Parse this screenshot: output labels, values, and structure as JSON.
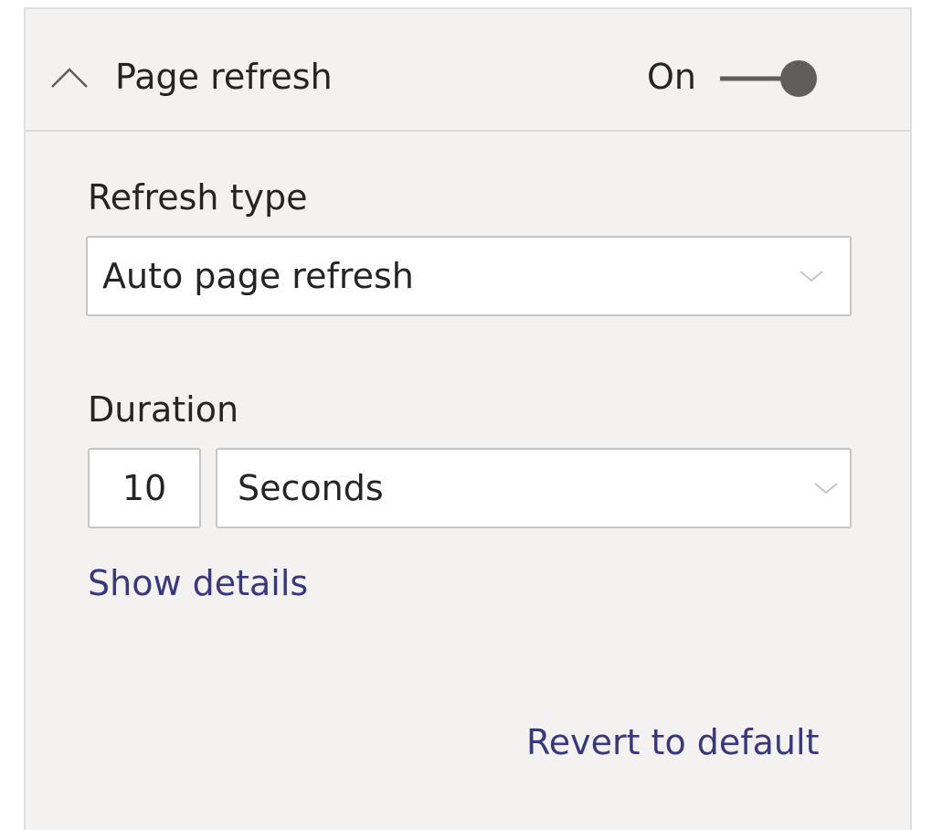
{
  "header": {
    "title": "Page refresh",
    "toggle_label": "On",
    "toggle_state": "on",
    "collapse_icon": "chevron-up-icon"
  },
  "refresh_type": {
    "label": "Refresh type",
    "selected": "Auto page refresh",
    "dropdown_icon": "chevron-down-icon"
  },
  "duration": {
    "label": "Duration",
    "value": "10",
    "unit": "Seconds",
    "dropdown_icon": "chevron-down-icon"
  },
  "links": {
    "show_details": "Show details",
    "revert": "Revert to default"
  },
  "colors": {
    "panel_bg": "#f3f2f1",
    "link": "#3a3781",
    "toggle": "#605e5c",
    "text": "#252423"
  }
}
